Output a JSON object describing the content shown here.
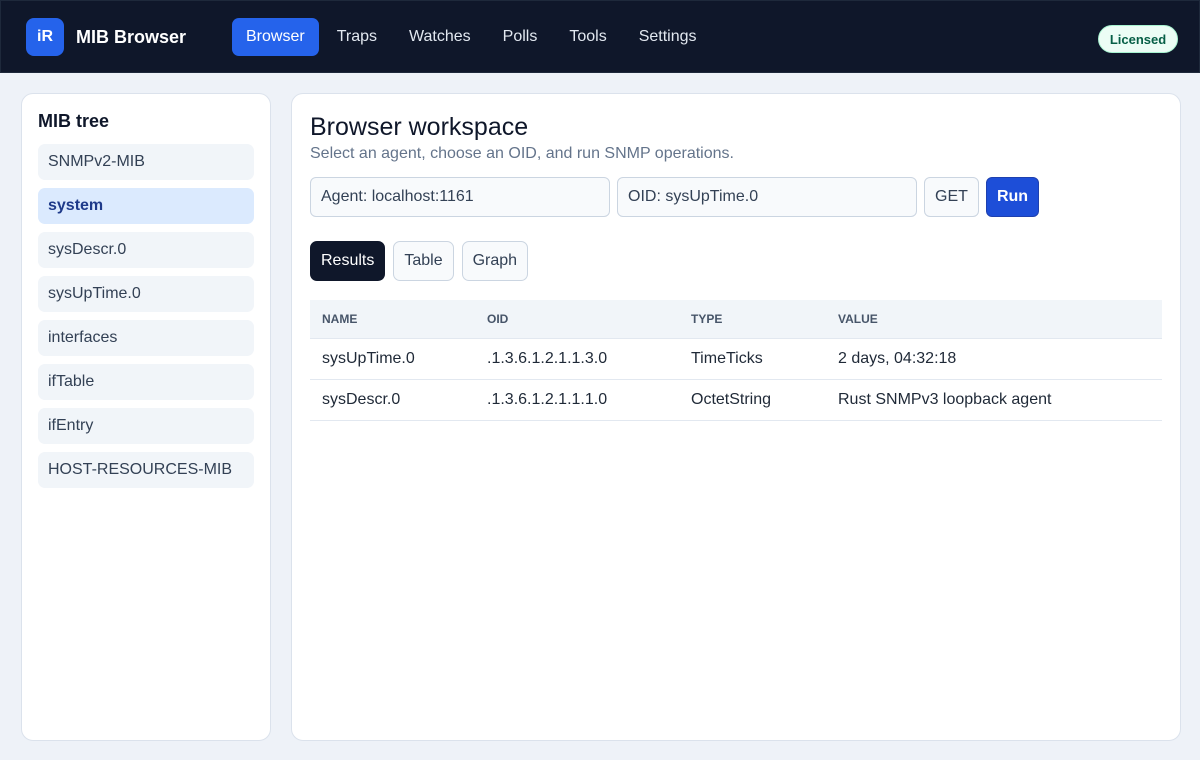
{
  "app": {
    "logo_text": "iR",
    "title": "MIB Browser",
    "license_badge": "Licensed",
    "accent": "#2563eb"
  },
  "nav": [
    {
      "label": "Browser",
      "active": true
    },
    {
      "label": "Traps",
      "active": false
    },
    {
      "label": "Watches",
      "active": false
    },
    {
      "label": "Polls",
      "active": false
    },
    {
      "label": "Tools",
      "active": false
    },
    {
      "label": "Settings",
      "active": false
    }
  ],
  "sidebar": {
    "title": "MIB tree",
    "items": [
      {
        "label": "SNMPv2-MIB",
        "selected": false
      },
      {
        "label": "system",
        "selected": true
      },
      {
        "label": "sysDescr.0",
        "selected": false
      },
      {
        "label": "sysUpTime.0",
        "selected": false
      },
      {
        "label": "interfaces",
        "selected": false
      },
      {
        "label": "ifTable",
        "selected": false
      },
      {
        "label": "ifEntry",
        "selected": false
      },
      {
        "label": "HOST-RESOURCES-MIB",
        "selected": false
      }
    ]
  },
  "workspace": {
    "title": "Browser workspace",
    "subtitle": "Select an agent, choose an OID, and run SNMP operations.",
    "agent_value": "Agent: localhost:1161",
    "oid_value": "OID: sysUpTime.0",
    "operation": "GET",
    "run_label": "Run"
  },
  "tabs": [
    {
      "label": "Results",
      "active": true
    },
    {
      "label": "Table",
      "active": false
    },
    {
      "label": "Graph",
      "active": false
    }
  ],
  "table": {
    "columns": [
      "NAME",
      "OID",
      "TYPE",
      "VALUE"
    ],
    "rows": [
      [
        "sysUpTime.0",
        ".1.3.6.1.2.1.1.3.0",
        "TimeTicks",
        "2 days, 04:32:18"
      ],
      [
        "sysDescr.0",
        ".1.3.6.1.2.1.1.1.0",
        "OctetString",
        "Rust SNMPv3 loopback agent"
      ]
    ]
  }
}
